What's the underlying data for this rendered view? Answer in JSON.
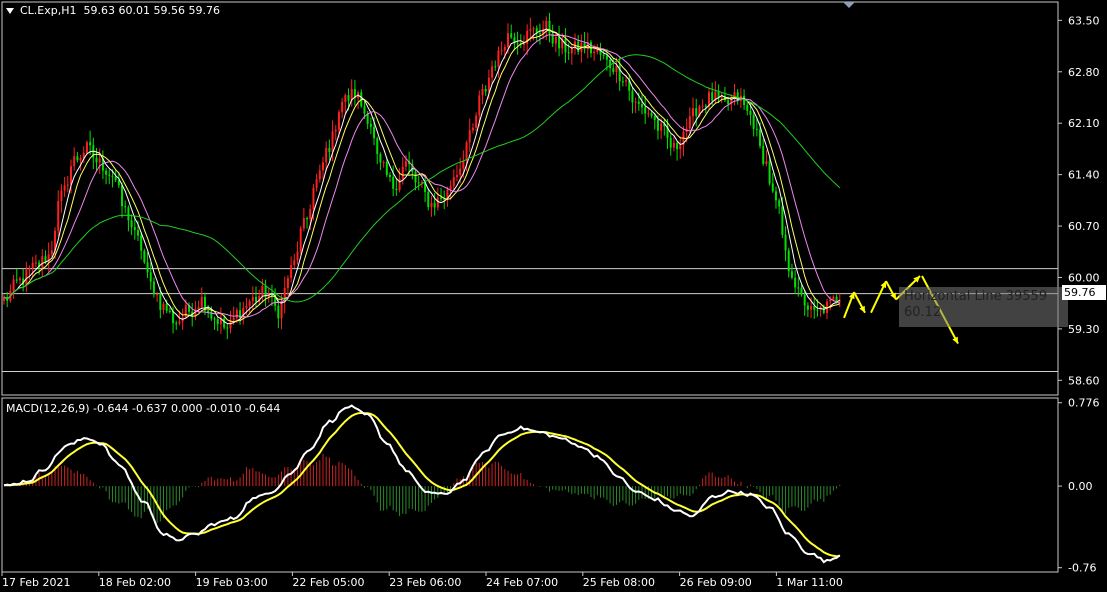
{
  "header": {
    "symbol_timeframe": "CL.Exp,H1",
    "ohlc": "59.63 60.01 59.56 59.76"
  },
  "macd_header": "MACD(12,26,9) -0.644 -0.637 0.000 -0.010 -0.644",
  "tooltip": {
    "line1": "Horizontal Line 39559",
    "line2": "60.12"
  },
  "current_price_label": "59.76",
  "colors": {
    "background": "#000000",
    "bull_candle": "#ff2020",
    "bear_candle": "#00e000",
    "ma_fast": "#ffffff",
    "ma_mid": "#ffff66",
    "ma_slow": "#ee88ee",
    "ma_long": "#22cc22",
    "macd_line": "#ffffff",
    "signal_line": "#ffff33",
    "hist_pos": "#cc2222",
    "hist_neg": "#2a8a2a",
    "arrow": "#ffff00"
  },
  "chart_data": [
    {
      "type": "candlestick",
      "title": "CL.Exp,H1",
      "ylim": [
        58.4,
        63.75
      ],
      "y_ticks": [
        "63.50",
        "62.80",
        "62.10",
        "61.40",
        "60.70",
        "60.00",
        "59.30",
        "58.60"
      ],
      "x_ticks": [
        "17 Feb 2021",
        "18 Feb 02:00",
        "19 Feb 03:00",
        "22 Feb 05:00",
        "23 Feb 06:00",
        "24 Feb 07:00",
        "25 Feb 08:00",
        "26 Feb 09:00",
        "1 Mar 11:00"
      ],
      "horizontal_lines": [
        60.12,
        59.78,
        58.72
      ],
      "close_anchors": [
        [
          0,
          59.7
        ],
        [
          5,
          59.95
        ],
        [
          10,
          60.15
        ],
        [
          14,
          60.3
        ],
        [
          18,
          61.1
        ],
        [
          22,
          61.6
        ],
        [
          26,
          61.75
        ],
        [
          30,
          61.55
        ],
        [
          34,
          61.4
        ],
        [
          38,
          60.9
        ],
        [
          42,
          60.5
        ],
        [
          46,
          59.9
        ],
        [
          50,
          59.6
        ],
        [
          54,
          59.4
        ],
        [
          58,
          59.55
        ],
        [
          62,
          59.7
        ],
        [
          66,
          59.45
        ],
        [
          70,
          59.3
        ],
        [
          74,
          59.55
        ],
        [
          78,
          59.7
        ],
        [
          82,
          59.8
        ],
        [
          86,
          59.55
        ],
        [
          90,
          60.1
        ],
        [
          94,
          60.7
        ],
        [
          98,
          61.3
        ],
        [
          102,
          61.8
        ],
        [
          106,
          62.4
        ],
        [
          110,
          62.5
        ],
        [
          114,
          62.2
        ],
        [
          118,
          61.5
        ],
        [
          122,
          61.25
        ],
        [
          126,
          61.55
        ],
        [
          130,
          61.25
        ],
        [
          134,
          61.0
        ],
        [
          138,
          61.1
        ],
        [
          142,
          61.45
        ],
        [
          146,
          61.9
        ],
        [
          150,
          62.5
        ],
        [
          154,
          62.95
        ],
        [
          158,
          63.3
        ],
        [
          162,
          63.25
        ],
        [
          166,
          63.35
        ],
        [
          170,
          63.4
        ],
        [
          174,
          63.15
        ],
        [
          178,
          63.1
        ],
        [
          182,
          63.15
        ],
        [
          186,
          63.05
        ],
        [
          190,
          62.9
        ],
        [
          194,
          62.75
        ],
        [
          198,
          62.35
        ],
        [
          202,
          62.25
        ],
        [
          206,
          62.0
        ],
        [
          210,
          61.75
        ],
        [
          214,
          62.05
        ],
        [
          218,
          62.35
        ],
        [
          222,
          62.45
        ],
        [
          226,
          62.35
        ],
        [
          230,
          62.45
        ],
        [
          234,
          62.2
        ],
        [
          238,
          61.65
        ],
        [
          242,
          61.0
        ],
        [
          246,
          60.15
        ],
        [
          250,
          59.7
        ],
        [
          254,
          59.5
        ],
        [
          258,
          59.6
        ],
        [
          262,
          59.76
        ]
      ],
      "moving_averages": [
        {
          "periods": 5,
          "color": "ma_fast"
        },
        {
          "periods": 8,
          "color": "ma_mid"
        },
        {
          "periods": 14,
          "color": "ma_slow"
        },
        {
          "periods": 50,
          "color": "ma_long"
        }
      ],
      "forecast_arrows": [
        {
          "from": [
            59.45,
            844
          ],
          "to": [
            59.8,
            854
          ]
        },
        {
          "from": [
            59.8,
            854
          ],
          "to": [
            59.52,
            865
          ]
        },
        {
          "from": [
            59.52,
            871
          ],
          "to": [
            59.95,
            886
          ]
        },
        {
          "from": [
            59.95,
            886
          ],
          "to": [
            59.7,
            896
          ]
        },
        {
          "from": [
            59.7,
            896
          ],
          "to": [
            60.02,
            920
          ]
        },
        {
          "from": [
            60.02,
            922
          ],
          "to": [
            59.1,
            958
          ]
        }
      ]
    },
    {
      "type": "macd",
      "title": "MACD(12,26,9)",
      "ylim": [
        -0.8,
        0.82
      ],
      "y_ticks": [
        "0.776",
        "0.00",
        "-0.76"
      ],
      "macd_anchors": [
        [
          0,
          0.0
        ],
        [
          8,
          0.05
        ],
        [
          12,
          0.15
        ],
        [
          20,
          0.38
        ],
        [
          26,
          0.45
        ],
        [
          30,
          0.4
        ],
        [
          36,
          0.2
        ],
        [
          44,
          -0.15
        ],
        [
          50,
          -0.45
        ],
        [
          54,
          -0.5
        ],
        [
          60,
          -0.45
        ],
        [
          66,
          -0.35
        ],
        [
          72,
          -0.3
        ],
        [
          78,
          -0.12
        ],
        [
          84,
          -0.05
        ],
        [
          90,
          0.12
        ],
        [
          96,
          0.35
        ],
        [
          102,
          0.6
        ],
        [
          108,
          0.74
        ],
        [
          114,
          0.66
        ],
        [
          120,
          0.4
        ],
        [
          126,
          0.15
        ],
        [
          132,
          -0.05
        ],
        [
          138,
          -0.08
        ],
        [
          144,
          0.05
        ],
        [
          150,
          0.3
        ],
        [
          156,
          0.48
        ],
        [
          162,
          0.54
        ],
        [
          168,
          0.5
        ],
        [
          174,
          0.45
        ],
        [
          180,
          0.38
        ],
        [
          186,
          0.28
        ],
        [
          192,
          0.1
        ],
        [
          198,
          -0.05
        ],
        [
          204,
          -0.12
        ],
        [
          210,
          -0.22
        ],
        [
          216,
          -0.28
        ],
        [
          222,
          -0.1
        ],
        [
          228,
          -0.05
        ],
        [
          234,
          -0.08
        ],
        [
          240,
          -0.2
        ],
        [
          246,
          -0.45
        ],
        [
          252,
          -0.62
        ],
        [
          258,
          -0.7
        ],
        [
          262,
          -0.644
        ]
      ],
      "signal_periods": 9
    }
  ]
}
